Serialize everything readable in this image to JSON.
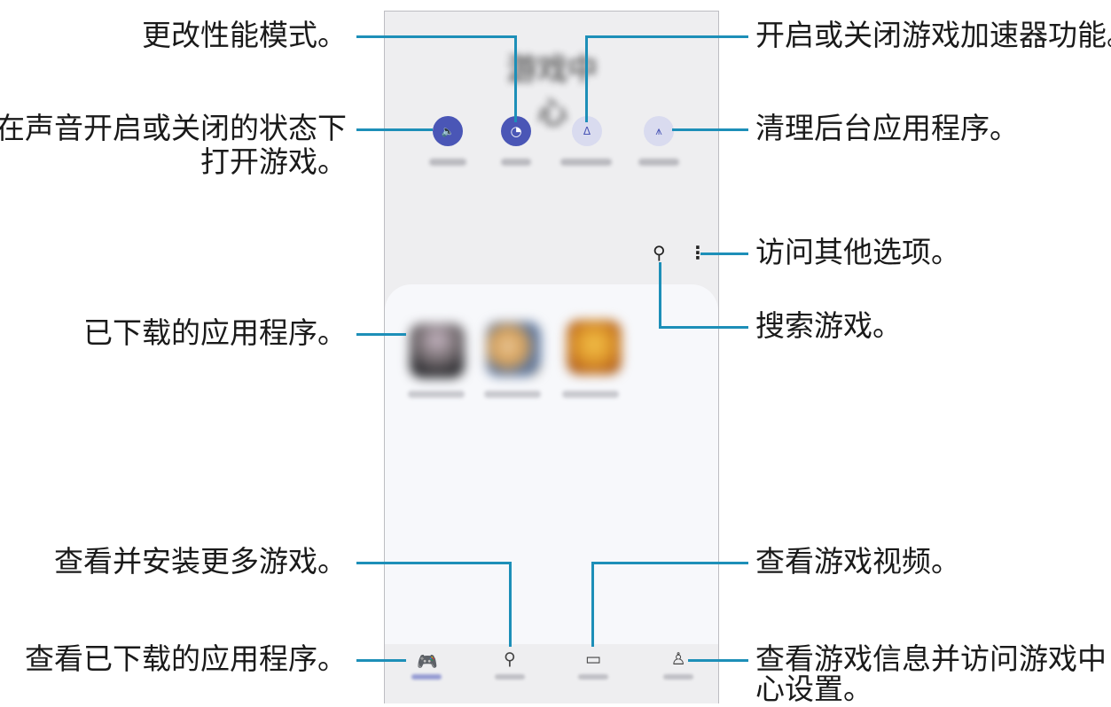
{
  "callouts": {
    "performance_mode": "更改性能模式。",
    "booster": "开启或关闭游戏加速器功能。",
    "sound_line1": "在声音开启或关闭的状态下",
    "sound_line2": "打开游戏。",
    "clean_background": "清理后台应用程序。",
    "more_options": "访问其他选项。",
    "downloaded_apps": "已下载的应用程序。",
    "search_games": "搜索游戏。",
    "install_games": "查看并安装更多游戏。",
    "game_videos": "查看游戏视频。",
    "library": "查看已下载的应用程序。",
    "profile_line1": "查看游戏信息并访问游戏中",
    "profile_line2": "心设置。"
  },
  "phone": {
    "title": "游戏中心",
    "quick_buttons": [
      {
        "icon": "speaker-icon",
        "glyph": "🔈"
      },
      {
        "icon": "performance-icon",
        "glyph": "◔"
      },
      {
        "icon": "booster-icon",
        "glyph": "Δ"
      },
      {
        "icon": "broom-icon",
        "glyph": "⩚"
      }
    ],
    "toolbar": {
      "search_glyph": "⚲",
      "more_glyph": "⋮"
    },
    "nav": [
      {
        "icon": "gamepad-icon",
        "glyph": "🎮"
      },
      {
        "icon": "search-icon",
        "glyph": "⚲"
      },
      {
        "icon": "video-icon",
        "glyph": "▭"
      },
      {
        "icon": "profile-icon",
        "glyph": "♙"
      }
    ]
  },
  "colors": {
    "accent": "#4a56b6",
    "leader_line": "#1d8fb8"
  }
}
